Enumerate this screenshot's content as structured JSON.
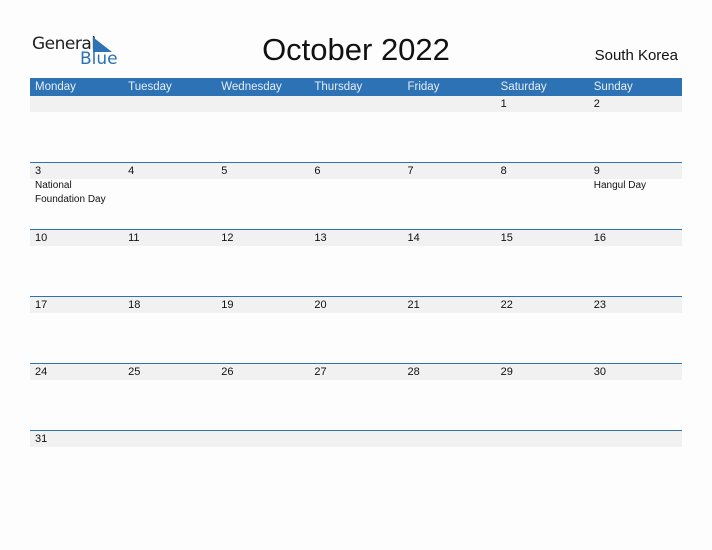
{
  "logo": {
    "general": "General",
    "blue": "Blue"
  },
  "title": "October 2022",
  "country": "South Korea",
  "weekdays": [
    "Monday",
    "Tuesday",
    "Wednesday",
    "Thursday",
    "Friday",
    "Saturday",
    "Sunday"
  ],
  "weeks": [
    {
      "days": [
        "",
        "",
        "",
        "",
        "",
        "1",
        "2"
      ],
      "events": [
        "",
        "",
        "",
        "",
        "",
        "",
        ""
      ]
    },
    {
      "days": [
        "3",
        "4",
        "5",
        "6",
        "7",
        "8",
        "9"
      ],
      "events": [
        "National Foundation Day",
        "",
        "",
        "",
        "",
        "",
        "Hangul Day"
      ]
    },
    {
      "days": [
        "10",
        "11",
        "12",
        "13",
        "14",
        "15",
        "16"
      ],
      "events": [
        "",
        "",
        "",
        "",
        "",
        "",
        ""
      ]
    },
    {
      "days": [
        "17",
        "18",
        "19",
        "20",
        "21",
        "22",
        "23"
      ],
      "events": [
        "",
        "",
        "",
        "",
        "",
        "",
        ""
      ]
    },
    {
      "days": [
        "24",
        "25",
        "26",
        "27",
        "28",
        "29",
        "30"
      ],
      "events": [
        "",
        "",
        "",
        "",
        "",
        "",
        ""
      ]
    },
    {
      "days": [
        "31",
        "",
        "",
        "",
        "",
        "",
        ""
      ],
      "events": [
        "",
        "",
        "",
        "",
        "",
        "",
        ""
      ]
    }
  ]
}
